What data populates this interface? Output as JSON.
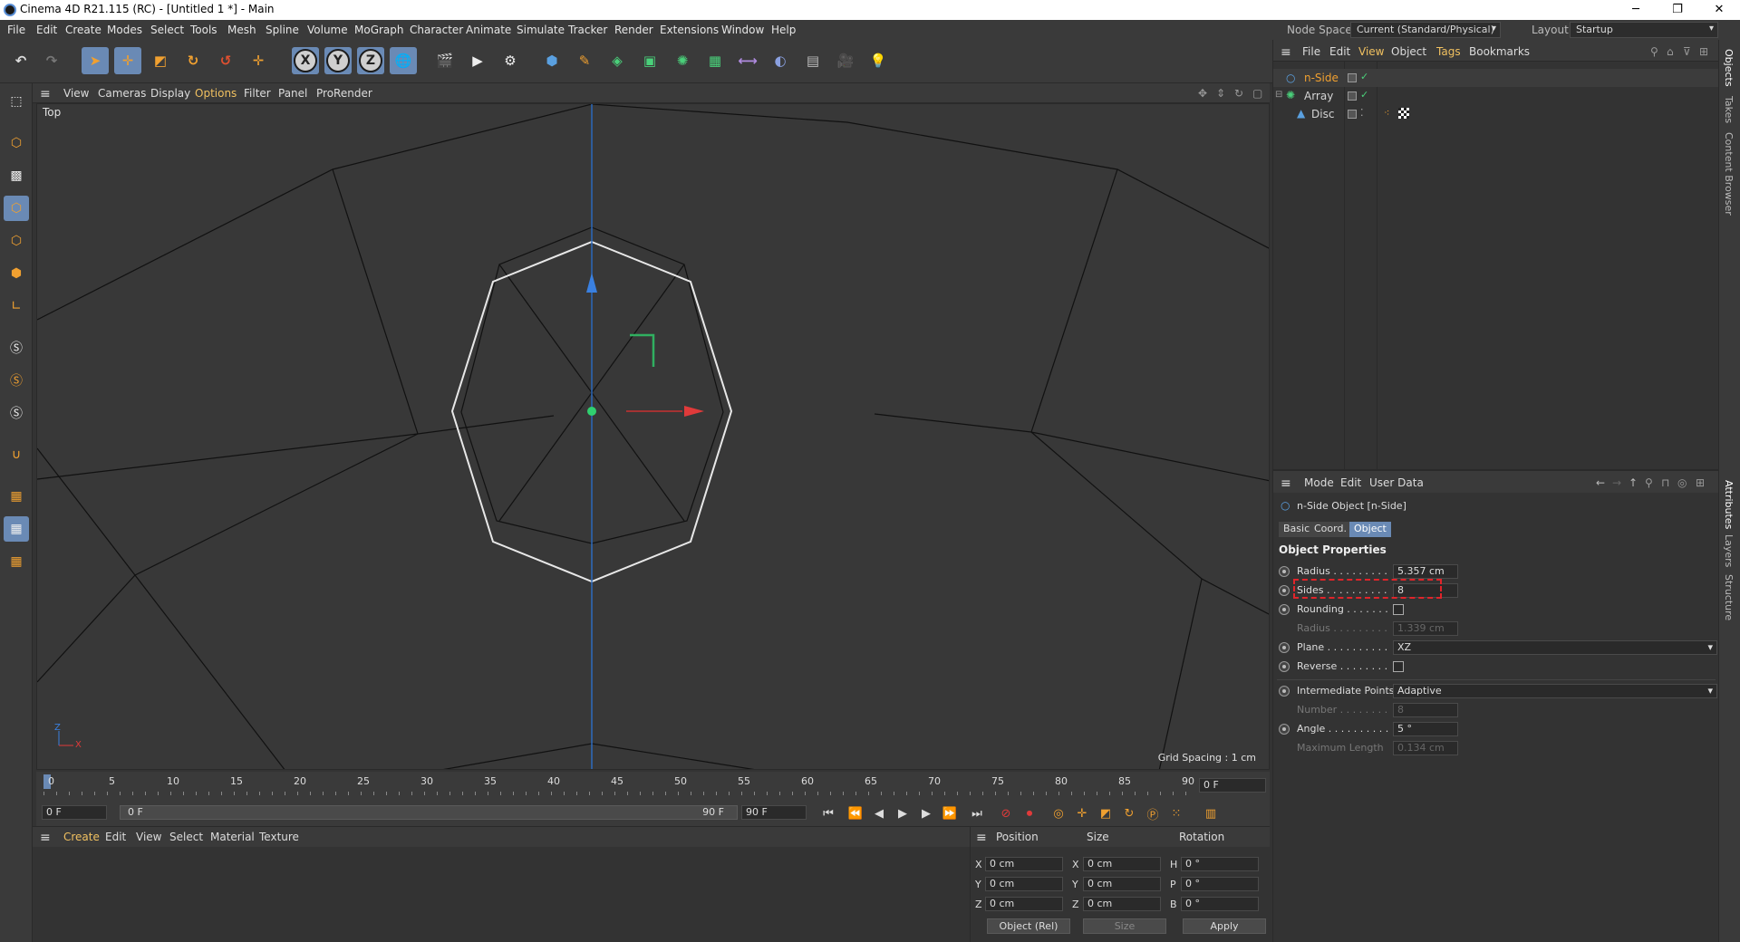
{
  "window": {
    "title": "Cinema 4D R21.115 (RC) - [Untitled 1 *] - Main",
    "minimize": "─",
    "maximize": "❐",
    "close": "✕"
  },
  "menu": [
    "File",
    "Edit",
    "Create",
    "Modes",
    "Select",
    "Tools",
    "Mesh",
    "Spline",
    "Volume",
    "MoGraph",
    "Character",
    "Animate",
    "Simulate",
    "Tracker",
    "Render",
    "Extensions",
    "Window",
    "Help"
  ],
  "nodespace": {
    "label": "Node Space:",
    "value": "Current (Standard/Physical)"
  },
  "layout": {
    "label": "Layout:",
    "value": "Startup"
  },
  "toolbar": {
    "undo": "↶",
    "redo": "↷",
    "x": "X",
    "y": "Y",
    "z": "Z"
  },
  "viewport": {
    "menu": [
      "View",
      "Cameras",
      "Display",
      "Options",
      "Filter",
      "Panel",
      "ProRender"
    ],
    "label": "Top",
    "grid_spacing": "Grid Spacing : 1 cm",
    "axis_z": "Z",
    "axis_x": "X"
  },
  "timeline": {
    "ticks": [
      "0",
      "5",
      "10",
      "15",
      "20",
      "25",
      "30",
      "35",
      "40",
      "45",
      "50",
      "55",
      "60",
      "65",
      "70",
      "75",
      "80",
      "85",
      "90"
    ],
    "current": "0 F"
  },
  "playbar": {
    "start": "0 F",
    "slider_start": "0 F",
    "slider_end": "90 F",
    "end": "90 F"
  },
  "material": {
    "menu": [
      "Create",
      "Edit",
      "View",
      "Select",
      "Material",
      "Texture"
    ]
  },
  "coords": {
    "headers": [
      "Position",
      "Size",
      "Rotation"
    ],
    "rows": [
      {
        "a": "X",
        "p": "0 cm",
        "b": "X",
        "s": "0 cm",
        "c": "H",
        "r": "0 °"
      },
      {
        "a": "Y",
        "p": "0 cm",
        "b": "Y",
        "s": "0 cm",
        "c": "P",
        "r": "0 °"
      },
      {
        "a": "Z",
        "p": "0 cm",
        "b": "Z",
        "s": "0 cm",
        "c": "B",
        "r": "0 °"
      }
    ],
    "mode": "Object (Rel)",
    "size_mode": "Size",
    "apply": "Apply"
  },
  "objects": {
    "menu": [
      "File",
      "Edit",
      "View",
      "Object",
      "Tags",
      "Bookmarks"
    ],
    "items": [
      {
        "name": "n-Side",
        "color": "#f0a030"
      },
      {
        "name": "Array",
        "color": "#dcdcdc"
      },
      {
        "name": "Disc",
        "color": "#dcdcdc"
      }
    ]
  },
  "attributes": {
    "menu": [
      "Mode",
      "Edit",
      "User Data"
    ],
    "object_title": "n-Side Object [n-Side]",
    "tabs": [
      "Basic",
      "Coord.",
      "Object"
    ],
    "section": "Object Properties",
    "props": [
      {
        "label": "Radius . . . . . . . . .",
        "value": "5.357 cm"
      },
      {
        "label": "Sides . . . . . . . . . .",
        "value": "8"
      },
      {
        "label": "Rounding . . . . . . ."
      },
      {
        "label": "Radius . . . . . . . . .",
        "value": "1.339 cm"
      },
      {
        "label": "Plane . . . . . . . . . .",
        "value": "XZ"
      },
      {
        "label": "Reverse . . . . . . . ."
      },
      {
        "label": "Intermediate Points",
        "value": "Adaptive"
      },
      {
        "label": "Number . . . . . . . .",
        "value": "8"
      },
      {
        "label": "Angle . . . . . . . . . .",
        "value": "5 °"
      },
      {
        "label": "Maximum Length",
        "value": "0.134 cm"
      }
    ]
  },
  "sidetabs": [
    "Objects",
    "Takes",
    "Content Browser",
    "Attributes",
    "Layers",
    "Structure"
  ],
  "colors": {
    "accent": "#6a8ab5",
    "bg": "#333333",
    "panel": "#3a3a3a",
    "highlight": "#e0242a"
  }
}
